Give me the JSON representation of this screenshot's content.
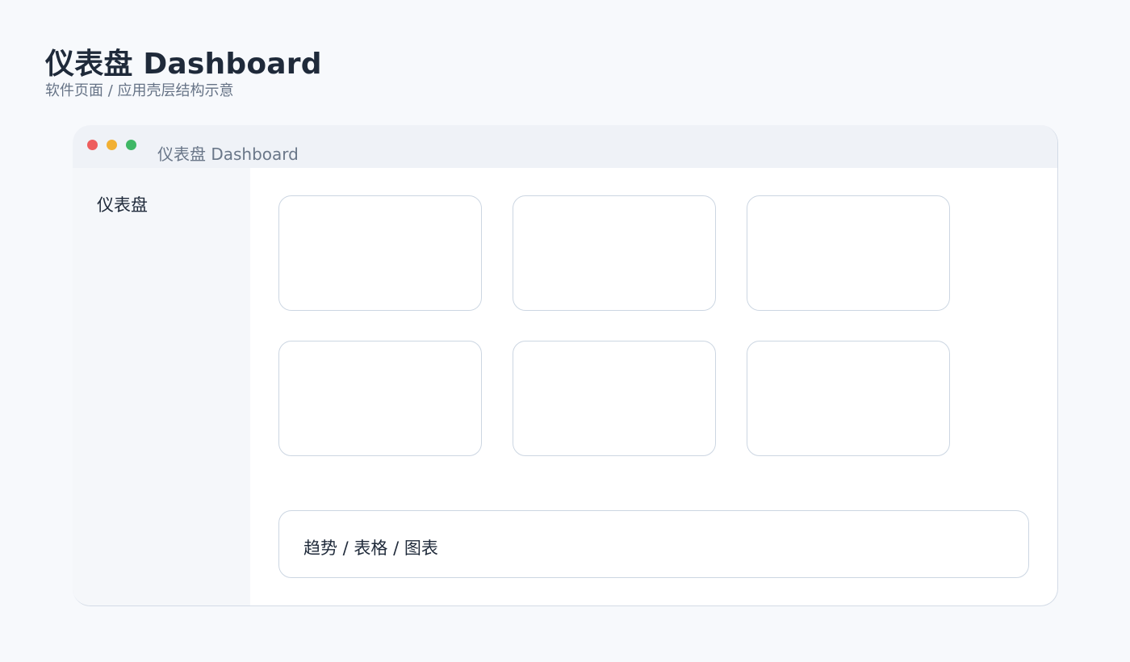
{
  "header": {
    "title": "仪表盘 Dashboard",
    "subtitle": "软件页面 / 应用壳层结构示意"
  },
  "window": {
    "title": "仪表盘 Dashboard",
    "controls": [
      "close",
      "minimize",
      "maximize"
    ],
    "colors": {
      "close": "#ee5d5d",
      "minimize": "#f2b033",
      "maximize": "#3fb765"
    }
  },
  "sidebar": {
    "items": [
      {
        "label": "仪表盘"
      }
    ]
  },
  "main": {
    "trend_panel_label": "趋势 / 表格 / 图表"
  }
}
